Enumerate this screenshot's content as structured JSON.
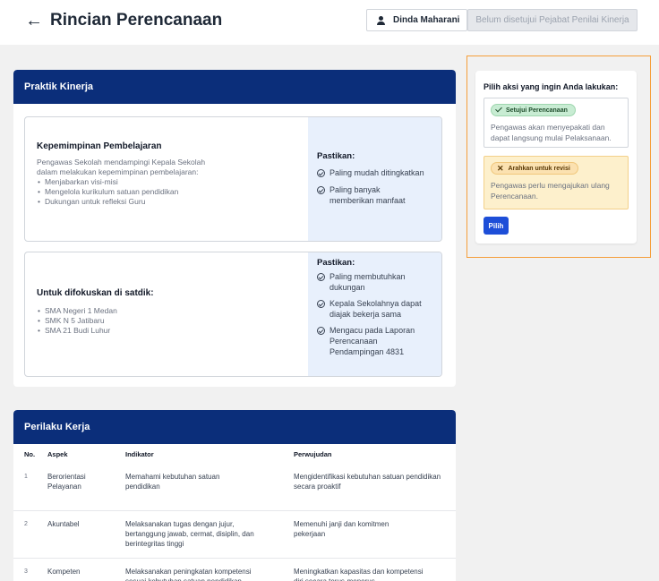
{
  "header": {
    "back_icon": "arrow-left-icon",
    "title": "Rincian Perencanaan",
    "user_name": "Dinda Maharani",
    "user_icon": "user-icon",
    "status": "Belum disetujui Pejabat Penilai Kinerja"
  },
  "praktik": {
    "heading": "Praktik Kinerja",
    "card1": {
      "title": "Kepemimpinan Pembelajaran",
      "desc_line1": "Pengawas Sekolah mendampingi Kepala Sekolah",
      "desc_line2": "dalam melakukan kepemimpinan pembelajaran:",
      "bullets": [
        "Menjabarkan visi-misi",
        "Mengelola kurikulum satuan pendidikan",
        "Dukungan untuk refleksi Guru"
      ],
      "pastikan_label": "Pastikan:",
      "checks": [
        "Paling mudah ditingkatkan",
        "Paling banyak memberikan manfaat"
      ]
    },
    "card2": {
      "title": "Untuk difokuskan di satdik:",
      "bullets": [
        "SMA Negeri 1 Medan",
        "SMK N 5 Jatibaru",
        "SMA 21 Budi Luhur"
      ],
      "pastikan_label": "Pastikan:",
      "checks": [
        "Paling membutuhkan dukungan",
        "Kepala Sekolahnya dapat diajak bekerja sama",
        "Mengacu pada Laporan Perencanaan Pendampingan 4831"
      ]
    }
  },
  "perilaku": {
    "heading": "Perilaku Kerja",
    "columns": [
      "No.",
      "Aspek",
      "Indikator",
      "Perwujudan"
    ],
    "rows": [
      {
        "no": "1",
        "aspek": "Berorientasi Pelayanan",
        "indikator": "Memahami kebutuhan satuan pendidikan",
        "perwujudan": "Mengidentifikasi kebutuhan satuan pendidikan secara proaktif"
      },
      {
        "no": "2",
        "aspek": "Akuntabel",
        "indikator": "Melaksanakan tugas dengan jujur, bertanggung jawab, cermat, disiplin, dan berintegritas tinggi",
        "perwujudan": "Memenuhi janji dan komitmen pekerjaan"
      },
      {
        "no": "3",
        "aspek": "Kompeten",
        "indikator": "Melaksanakan peningkatan kompetensi sesuai kebutuhan satuan pendidikan",
        "perwujudan": "Meningkatkan kapasitas dan kompetensi diri secara terus-menerus"
      }
    ]
  },
  "action": {
    "title": "Pilih aksi yang ingin Anda lakukan:",
    "option1_label": "Setujui Perencanaan",
    "option1_icon": "check-icon",
    "option1_desc": "Pengawas akan menyepakati dan dapat langsung mulai Pelaksanaan.",
    "option2_label": "Arahkan untuk revisi",
    "option2_icon": "x-icon",
    "option2_desc": "Pengawas perlu mengajukan ulang Perencanaan.",
    "button_label": "Pilih"
  }
}
